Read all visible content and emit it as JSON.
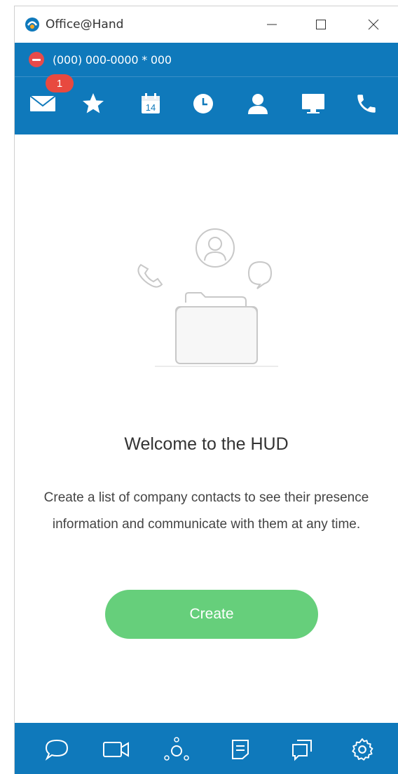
{
  "window": {
    "title": "Office@Hand"
  },
  "header": {
    "phone_number": "(000) 000-0000 * 000",
    "status_color": "#e84a4a"
  },
  "nav": {
    "items": [
      {
        "icon": "envelope-icon",
        "badge": "1"
      },
      {
        "icon": "star-icon"
      },
      {
        "icon": "calendar-icon",
        "label": "14"
      },
      {
        "icon": "clock-icon"
      },
      {
        "icon": "person-icon"
      },
      {
        "icon": "monitor-icon"
      },
      {
        "icon": "phone-icon"
      }
    ]
  },
  "main": {
    "title": "Welcome to the HUD",
    "description": "Create a list of company contacts to see their presence information and communicate with them at any time.",
    "create_label": "Create"
  },
  "footer": {
    "items": [
      {
        "icon": "chat-bubble-icon"
      },
      {
        "icon": "video-icon"
      },
      {
        "icon": "network-icon"
      },
      {
        "icon": "notes-icon"
      },
      {
        "icon": "conversations-icon"
      },
      {
        "icon": "settings-icon"
      }
    ]
  },
  "colors": {
    "brand_blue": "#0f79bb",
    "create_green": "#66cf7b",
    "badge_red": "#e8493f"
  }
}
